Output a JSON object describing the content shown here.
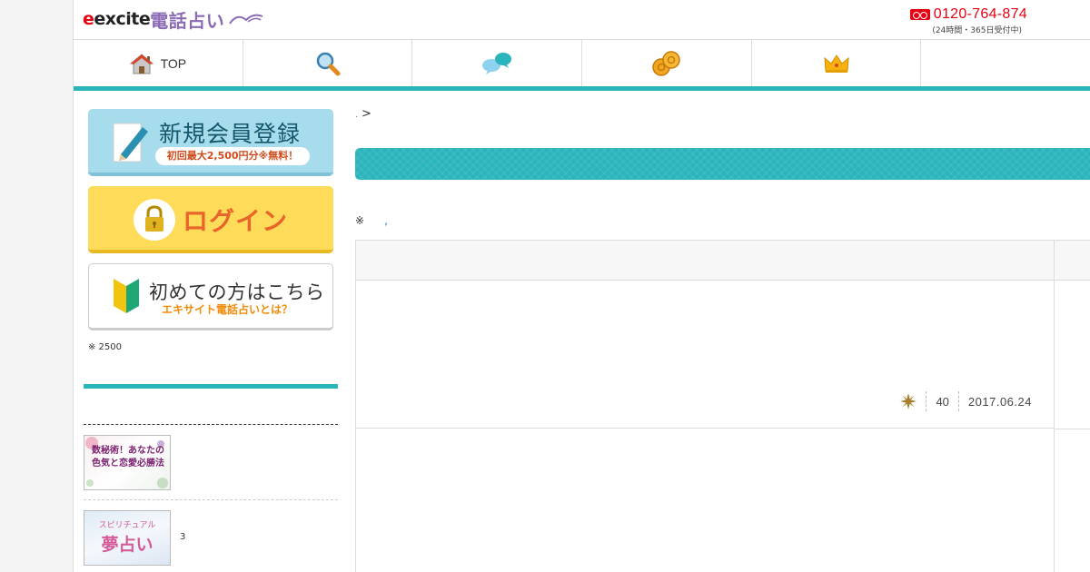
{
  "header": {
    "logo_brand": "excite",
    "logo_service": "電話占い",
    "phone_number": "0120-764-874",
    "phone_note": "(24時間・365日受付中)"
  },
  "nav": {
    "items": [
      {
        "label": "TOP",
        "icon": "home-icon"
      },
      {
        "label": "",
        "icon": "search-icon"
      },
      {
        "label": "",
        "icon": "chat-bubbles-icon"
      },
      {
        "label": "",
        "icon": "coins-icon"
      },
      {
        "label": "",
        "icon": "crown-icon"
      }
    ],
    "accent_color": "#2ab4bc"
  },
  "sidebar": {
    "register_title": "新規会員登録",
    "register_sub": "初回最大2,500円分※無料！",
    "login_label": "ログイン",
    "first_time_label": "初めての方はこちら",
    "first_time_sub": "エキサイト電話占いとは？",
    "note": "※ 2500",
    "thumbs": [
      {
        "text": "数秘術！あなたの色気と恋愛必勝法"
      },
      {
        "top_text": "スピリチュアル",
        "main_text": "夢占い",
        "count": "3"
      }
    ]
  },
  "main": {
    "breadcrumb_sep": ">",
    "note_mark": "※",
    "note_link": ",",
    "row1": {
      "count": "40",
      "date": "2017.06.24"
    }
  }
}
